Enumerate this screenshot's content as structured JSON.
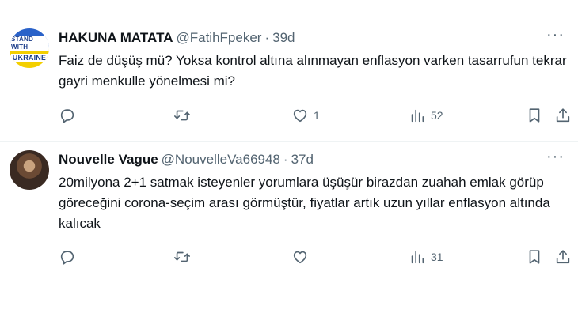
{
  "tweets": [
    {
      "avatar": {
        "line1": "STAND WITH",
        "line2": "UKRAINE"
      },
      "name": "HAKUNA MATATA",
      "handle": "@FatihFpeker",
      "separator": "·",
      "time": "39d",
      "text": "Faiz de düşüş mü? Yoksa kontrol altına alınmayan enflasyon varken tasarrufun tekrar gayri menkulle yönelmesi mi?",
      "likes": "1",
      "views": "52"
    },
    {
      "name": "Nouvelle Vague",
      "handle": "@NouvelleVa66948",
      "separator": "·",
      "time": "37d",
      "text": "20milyona 2+1 satmak isteyenler yorumlara üşüşür birazdan zuahah emlak görüp göreceğini corona-seçim arası görmüştür, fiyatlar artık uzun yıllar enflasyon altında kalıcak",
      "views": "31"
    }
  ],
  "icons": {
    "reply": "reply-icon",
    "retweet": "retweet-icon",
    "like": "heart-icon",
    "views": "views-icon",
    "bookmark": "bookmark-icon",
    "share": "share-icon",
    "more": "more-icon"
  },
  "colors": {
    "text": "#0f1419",
    "secondary": "#536471",
    "divider": "#eff3f4"
  }
}
